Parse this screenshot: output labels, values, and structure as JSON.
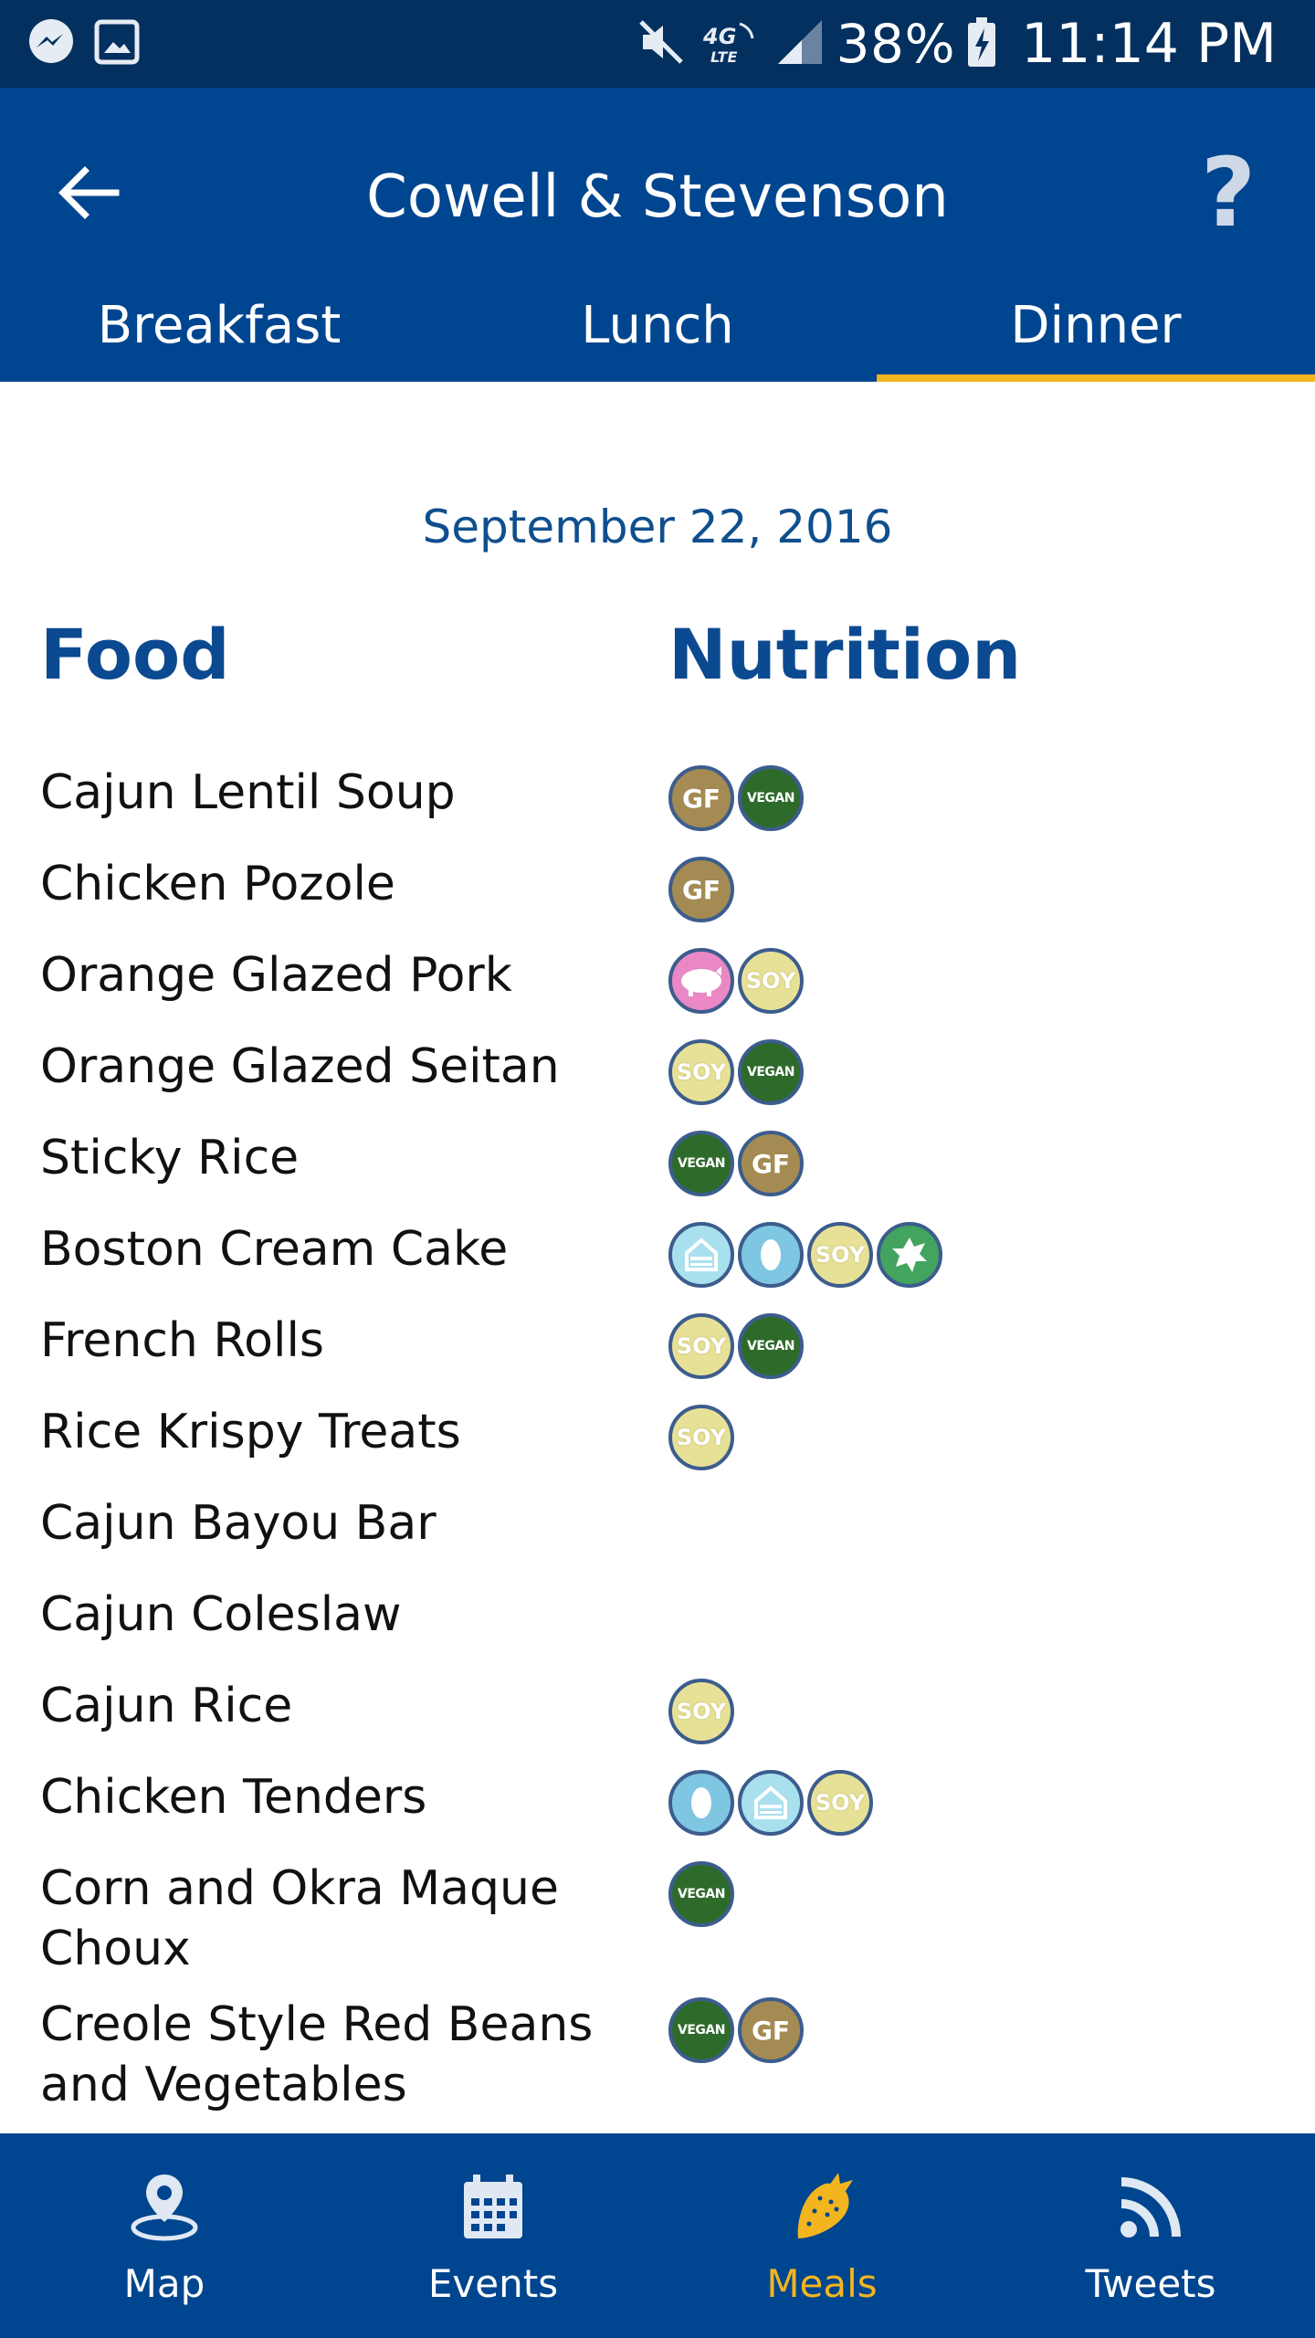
{
  "status_bar": {
    "battery_percent": "38%",
    "time": "11:14 PM",
    "network": "4G LTE"
  },
  "app_bar": {
    "title": "Cowell & Stevenson",
    "help_label": "?"
  },
  "tabs": [
    {
      "label": "Breakfast",
      "active": false
    },
    {
      "label": "Lunch",
      "active": false
    },
    {
      "label": "Dinner",
      "active": true
    }
  ],
  "menu": {
    "date": "September 22, 2016",
    "food_header": "Food",
    "nutrition_header": "Nutrition",
    "items": [
      {
        "name": "Cajun Lentil Soup",
        "badges": [
          "GF",
          "VEGAN"
        ]
      },
      {
        "name": "Chicken Pozole",
        "badges": [
          "GF"
        ]
      },
      {
        "name": "Orange Glazed Pork",
        "badges": [
          "PORK",
          "SOY"
        ]
      },
      {
        "name": "Orange Glazed Seitan",
        "badges": [
          "SOY",
          "VEGAN"
        ]
      },
      {
        "name": "Sticky Rice",
        "badges": [
          "VEGAN",
          "GF"
        ]
      },
      {
        "name": "Boston Cream Cake",
        "badges": [
          "DAIRY",
          "EGG",
          "SOY",
          "NUTS"
        ]
      },
      {
        "name": "French Rolls",
        "badges": [
          "SOY",
          "VEGAN"
        ]
      },
      {
        "name": "Rice Krispy Treats",
        "badges": [
          "SOY"
        ]
      },
      {
        "name": "Cajun Bayou Bar",
        "badges": []
      },
      {
        "name": "Cajun Coleslaw",
        "badges": []
      },
      {
        "name": "Cajun Rice",
        "badges": [
          "SOY"
        ]
      },
      {
        "name": "Chicken Tenders",
        "badges": [
          "EGG",
          "DAIRY",
          "SOY"
        ]
      },
      {
        "name": "Corn and Okra Maque Choux",
        "badges": [
          "VEGAN"
        ]
      },
      {
        "name": "Creole Style Red Beans and Vegetables",
        "badges": [
          "VEGAN",
          "GF"
        ]
      }
    ]
  },
  "bottom_nav": [
    {
      "label": "Map",
      "icon": "map-pin-icon",
      "active": false
    },
    {
      "label": "Events",
      "icon": "calendar-icon",
      "active": false
    },
    {
      "label": "Meals",
      "icon": "strawberry-icon",
      "active": true
    },
    {
      "label": "Tweets",
      "icon": "rss-icon",
      "active": false
    }
  ],
  "colors": {
    "status_bar": "#03305f",
    "primary": "#00458f",
    "accent": "#f2b51e",
    "heading_blue": "#0b4a90"
  }
}
